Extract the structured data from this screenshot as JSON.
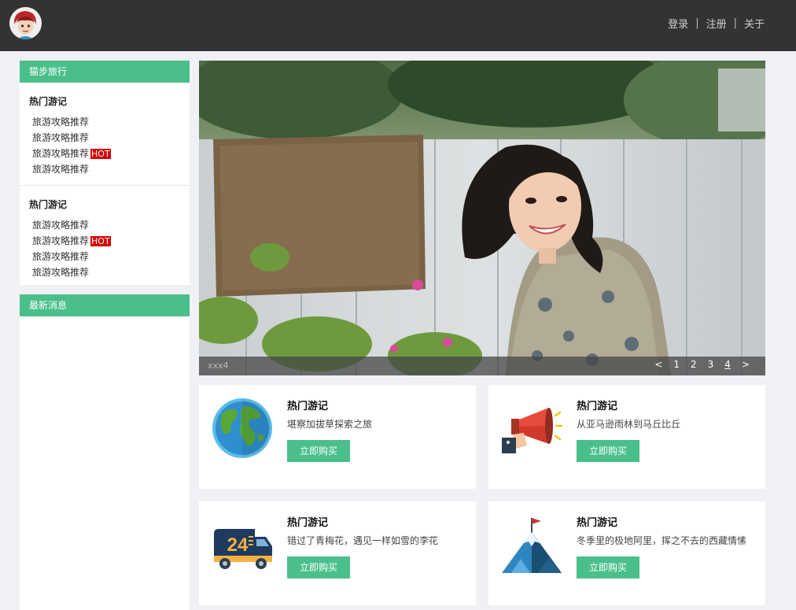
{
  "header": {
    "nav": [
      {
        "label": "登录"
      },
      {
        "label": "注册"
      },
      {
        "label": "关于"
      }
    ],
    "separator": "|"
  },
  "sidebar": {
    "panel1": {
      "title": "猫步旅行",
      "groups": [
        {
          "title": "热门游记",
          "items": [
            {
              "label": "旅游攻略推荐",
              "hot": ""
            },
            {
              "label": "旅游攻略推荐",
              "hot": ""
            },
            {
              "label": "旅游攻略推荐",
              "hot": "HOT"
            },
            {
              "label": "旅游攻略推荐",
              "hot": ""
            }
          ]
        },
        {
          "title": "热门游记",
          "items": [
            {
              "label": "旅游攻略推荐",
              "hot": ""
            },
            {
              "label": "旅游攻略推荐",
              "hot": "HOT"
            },
            {
              "label": "旅游攻略推荐",
              "hot": ""
            },
            {
              "label": "旅游攻略推荐",
              "hot": ""
            }
          ]
        }
      ]
    },
    "panel2": {
      "title": "最新消息"
    }
  },
  "carousel": {
    "caption": "xxx4",
    "prev": "<",
    "next": ">",
    "pages": [
      "1",
      "2",
      "3",
      "4"
    ],
    "active_page": "4"
  },
  "cards": [
    {
      "icon": "globe-icon",
      "title": "热门游记",
      "desc": "堪察加拔草探索之旅",
      "button": "立即购买"
    },
    {
      "icon": "megaphone-icon",
      "title": "热门游记",
      "desc": "从亚马逊雨林到马丘比丘",
      "button": "立即购买"
    },
    {
      "icon": "delivery-truck-icon",
      "title": "热门游记",
      "desc": "错过了青梅花，遇见一样如雪的李花",
      "button": "立即购买"
    },
    {
      "icon": "mountain-flag-icon",
      "title": "热门游记",
      "desc": "冬季里的极地阿里，挥之不去的西藏情愫",
      "button": "立即购买"
    }
  ],
  "colors": {
    "header_bg": "#333333",
    "accent": "#4bbf8a",
    "hot_badge": "#d40000",
    "page_bg": "#f0f1f5"
  }
}
